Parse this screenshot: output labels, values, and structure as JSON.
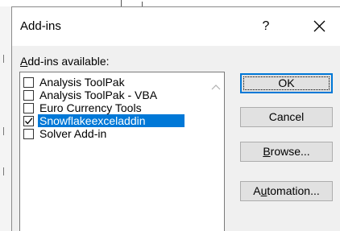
{
  "dialog": {
    "title": "Add-ins",
    "help_label": "?",
    "close_icon": "close-icon"
  },
  "list": {
    "label_accel": "A",
    "label_rest": "dd-ins available:",
    "items": [
      {
        "label": "Analysis ToolPak",
        "checked": false,
        "selected": false
      },
      {
        "label": "Analysis ToolPak - VBA",
        "checked": false,
        "selected": false
      },
      {
        "label": "Euro Currency Tools",
        "checked": false,
        "selected": false
      },
      {
        "label": "Snowflakeexceladdin",
        "checked": true,
        "selected": true
      },
      {
        "label": "Solver Add-in",
        "checked": false,
        "selected": false
      }
    ]
  },
  "buttons": {
    "ok": "OK",
    "cancel": "Cancel",
    "browse_accel": "B",
    "browse_rest": "rowse...",
    "automation_pre": "A",
    "automation_accel": "u",
    "automation_rest": "tomation..."
  },
  "colors": {
    "selection": "#0078d7",
    "dialog_bg": "#f0f0f0"
  }
}
